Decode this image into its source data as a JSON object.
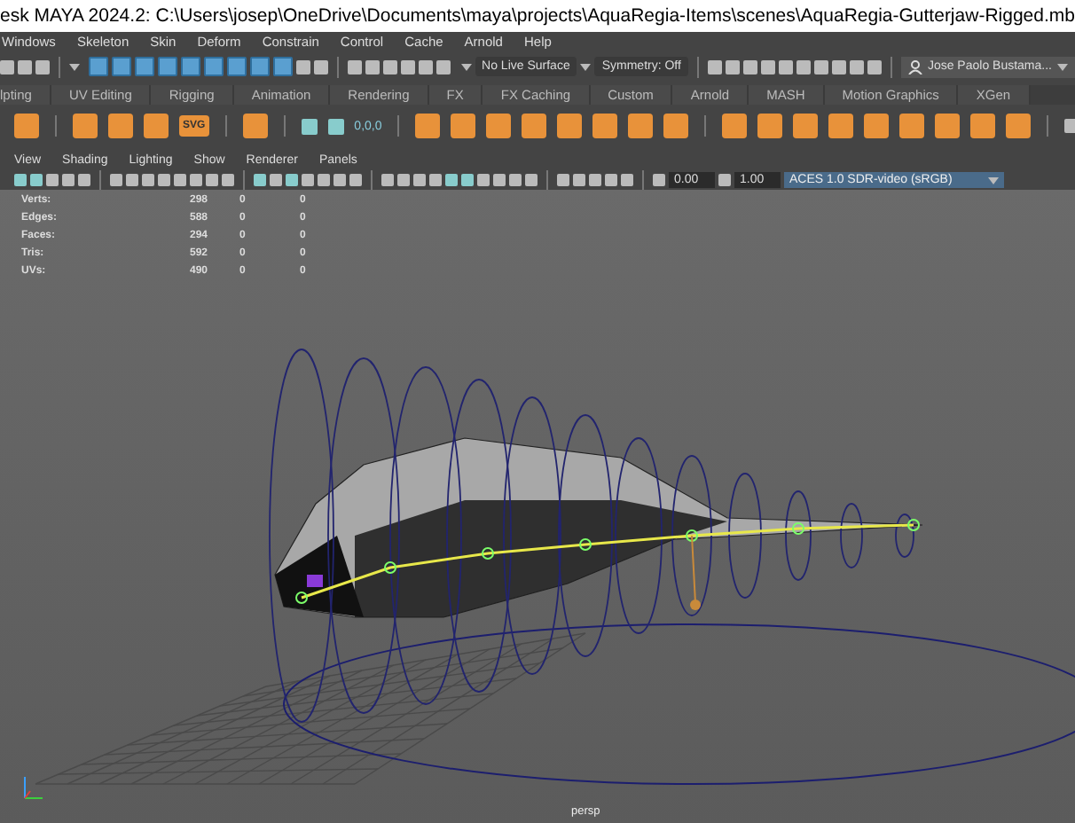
{
  "window": {
    "title": "esk MAYA 2024.2: C:\\Users\\josep\\OneDrive\\Documents\\maya\\projects\\AquaRegia-Items\\scenes\\AquaRegia-Gutterjaw-Rigged.mb"
  },
  "menu_bar": [
    "Windows",
    "Skeleton",
    "Skin",
    "Deform",
    "Constrain",
    "Control",
    "Cache",
    "Arnold",
    "Help"
  ],
  "status_line": {
    "live_surface": "No Live Surface",
    "symmetry": "Symmetry: Off",
    "user": "Jose Paolo Bustama..."
  },
  "shelf_tabs": [
    {
      "label": "lpting",
      "selected": false
    },
    {
      "label": "UV Editing",
      "selected": false
    },
    {
      "label": "Rigging",
      "selected": false
    },
    {
      "label": "Animation",
      "selected": false
    },
    {
      "label": "Rendering",
      "selected": false
    },
    {
      "label": "FX",
      "selected": false
    },
    {
      "label": "FX Caching",
      "selected": false
    },
    {
      "label": "Custom",
      "selected": false
    },
    {
      "label": "Arnold",
      "selected": false
    },
    {
      "label": "MASH",
      "selected": false
    },
    {
      "label": "Motion Graphics",
      "selected": false
    },
    {
      "label": "XGen",
      "selected": false
    }
  ],
  "shelf": {
    "svg_label": "SVG",
    "coord_label": "0,0,0"
  },
  "viewport": {
    "menus": [
      "View",
      "Shading",
      "Lighting",
      "Show",
      "Renderer",
      "Panels"
    ],
    "exposure": "0.00",
    "gamma": "1.00",
    "color_space": "ACES 1.0 SDR-video (sRGB)",
    "stats": [
      {
        "label": "Verts:",
        "values": [
          "298",
          "0",
          "0"
        ]
      },
      {
        "label": "Edges:",
        "values": [
          "588",
          "0",
          "0"
        ]
      },
      {
        "label": "Faces:",
        "values": [
          "294",
          "0",
          "0"
        ]
      },
      {
        "label": "Tris:",
        "values": [
          "592",
          "0",
          "0"
        ]
      },
      {
        "label": "UVs:",
        "values": [
          "490",
          "0",
          "0"
        ]
      }
    ],
    "camera": "persp"
  }
}
